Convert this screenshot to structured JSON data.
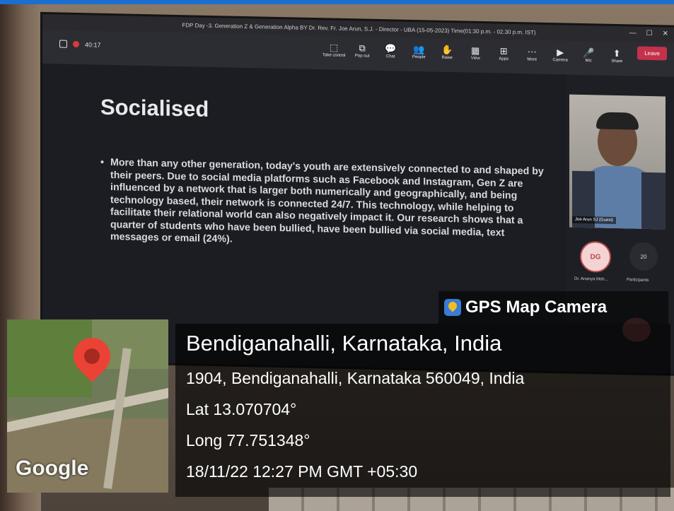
{
  "window": {
    "title": "FDP Day -3. Generation Z & Generation Alpha BY Dr. Rev. Fr. Joe Arun, S.J. - Director - UBA (15-05-2023) Time(01:30 p.m. - 02.30 p.m. IST)",
    "controls": [
      "—",
      "☐",
      "✕"
    ]
  },
  "meeting": {
    "timer": "40:17",
    "toolbar": [
      {
        "icon": "take-control-icon",
        "glyph": "⬚",
        "label": "Take control"
      },
      {
        "icon": "pop-out-icon",
        "glyph": "⧉",
        "label": "Pop out"
      },
      {
        "icon": "chat-icon",
        "glyph": "💬",
        "label": "Chat"
      },
      {
        "icon": "people-icon",
        "glyph": "👥",
        "label": "People"
      },
      {
        "icon": "raise-hand-icon",
        "glyph": "✋",
        "label": "Raise"
      },
      {
        "icon": "view-icon",
        "glyph": "▦",
        "label": "View"
      },
      {
        "icon": "apps-icon",
        "glyph": "⊞",
        "label": "Apps"
      },
      {
        "icon": "more-icon",
        "glyph": "⋯",
        "label": "More"
      },
      {
        "icon": "camera-icon",
        "glyph": "▶",
        "label": "Camera"
      },
      {
        "icon": "mic-icon",
        "glyph": "🎤",
        "label": "Mic"
      },
      {
        "icon": "share-icon",
        "glyph": "⬆",
        "label": "Share"
      }
    ],
    "leave_label": "Leave",
    "speaker_name": "Joe Arun SJ (Guest)",
    "participant_initials": "DG",
    "participant_name": "Dr. Ananya Moh...",
    "participant_count": "20",
    "participants_label": "Participants"
  },
  "slide": {
    "title": "Socialised",
    "bullet": "More than any other generation, today's youth are extensively connected to and shaped by their peers. Due to social media platforms such as Facebook and Instagram, Gen Z are influenced by a network that is larger both numerically and geographically, and being technology based, their network is connected 24/7. This technology, while helping to facilitate their relational world can also negatively impact it. Our research shows that a quarter of students who have been bullied, have been bullied via social media, text messages or email (24%)."
  },
  "gps": {
    "brand": "GPS Map Camera",
    "map_provider": "Google",
    "place": "Bendiganahalli, Karnataka, India",
    "address": "1904, Bendiganahalli, Karnataka 560049, India",
    "lat": "Lat 13.070704°",
    "long": "Long 77.751348°",
    "datetime": "18/11/22 12:27 PM GMT +05:30"
  },
  "colors": {
    "accent_bar": "#1b6fd0",
    "leave": "#c4314b",
    "pin": "#ea4335"
  }
}
